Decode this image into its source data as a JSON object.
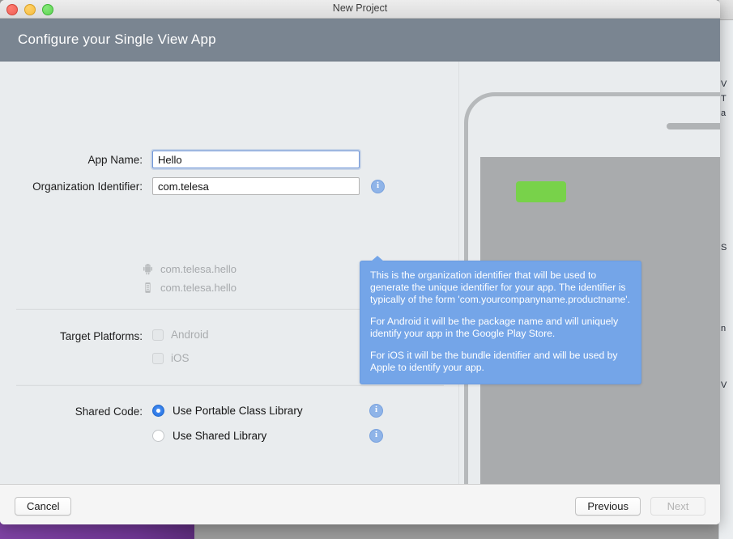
{
  "window": {
    "title": "New Project",
    "traffic_lights": [
      "close-button",
      "minimize-button",
      "zoom-button"
    ]
  },
  "header": {
    "title": "Configure your Single View App"
  },
  "form": {
    "app_name": {
      "label": "App Name:",
      "value": "Hello",
      "placeholder": ""
    },
    "org_identifier": {
      "label": "Organization Identifier:",
      "value": "com.telesa",
      "placeholder": ""
    },
    "bundle_previews": [
      {
        "icon": "android-icon",
        "text": "com.telesa.hello"
      },
      {
        "icon": "ios-device-icon",
        "text": "com.telesa.hello"
      }
    ],
    "target_platforms": {
      "label": "Target Platforms:",
      "options": [
        {
          "label": "Android",
          "checked": false,
          "enabled": false
        },
        {
          "label": "iOS",
          "checked": false,
          "enabled": false
        }
      ]
    },
    "shared_code": {
      "label": "Shared Code:",
      "options": [
        {
          "label": "Use Portable Class Library",
          "selected": true
        },
        {
          "label": "Use Shared Library",
          "selected": false
        }
      ]
    },
    "info_icon_glyph": "i"
  },
  "tooltip": {
    "visible": true,
    "paragraphs": [
      "This is the organization identifier that will be used to generate the unique identifier for your app. The identifier is typically of the form 'com.yourcompanyname.productname'.",
      "For Android it will be the package name and will uniquely identify your app in the Google Play Store.",
      "For iOS it will be the bundle identifier and will be used by Apple to identify your app."
    ],
    "background_color": "#74a5e8",
    "text_color": "#ffffff"
  },
  "preview": {
    "device": "phone-mockup",
    "accent_color": "#78d24a",
    "screen_color": "#a9abad"
  },
  "footer": {
    "cancel_label": "Cancel",
    "previous_label": "Previous",
    "next_label": "Next",
    "next_enabled": false
  },
  "background_window_fragments": [
    "V",
    "T",
    "a",
    "S",
    "n",
    "V"
  ],
  "colors": {
    "header_band": "#7a8591",
    "body": "#e9ecee",
    "tooltip": "#74a5e8",
    "radio_accent": "#2f7bea",
    "desktop_purple": "#7b3fa0"
  }
}
